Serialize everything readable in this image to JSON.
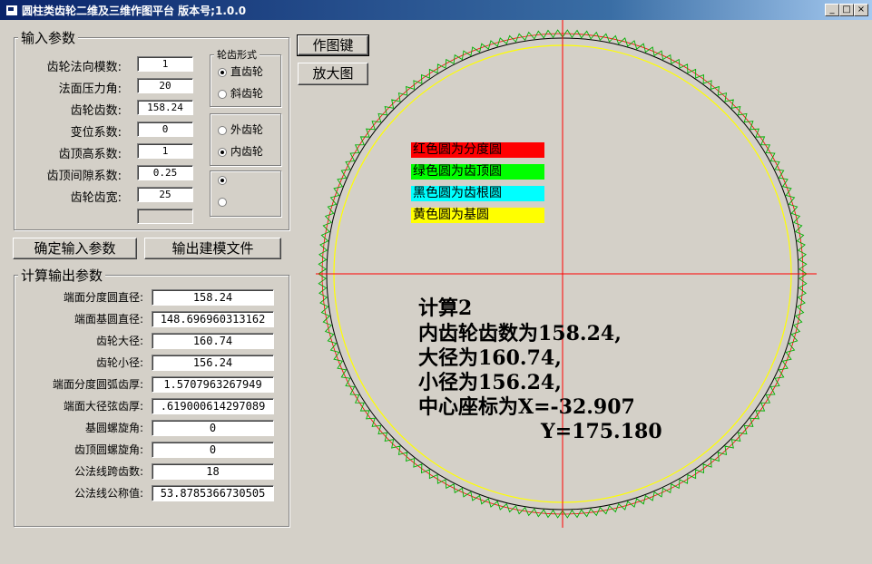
{
  "window": {
    "title": "圆柱类齿轮二维及三维作图平台 版本号;1.0.0",
    "controls": {
      "minimize": "_",
      "maximize": "□",
      "close": "×"
    }
  },
  "input": {
    "legend": "输入参数",
    "fields": [
      {
        "label": "齿轮法向模数:",
        "value": "1"
      },
      {
        "label": "法面压力角:",
        "value": "20"
      },
      {
        "label": "齿轮齿数:",
        "value": "158.24"
      },
      {
        "label": "变位系数:",
        "value": "0"
      },
      {
        "label": "齿顶高系数:",
        "value": "1"
      },
      {
        "label": "齿顶间隙系数:",
        "value": "0.25"
      },
      {
        "label": "齿轮齿宽:",
        "value": "25"
      }
    ],
    "extra_value": ""
  },
  "gear_type": {
    "legend": "轮齿形式",
    "options": [
      {
        "label": "直齿轮",
        "checked": true
      },
      {
        "label": "斜齿轮",
        "checked": false
      }
    ]
  },
  "mesh_type": {
    "options": [
      {
        "label": "外齿轮",
        "checked": false
      },
      {
        "label": "内齿轮",
        "checked": true
      }
    ]
  },
  "third_group": {
    "options": [
      {
        "label": "",
        "checked": true
      },
      {
        "label": "",
        "checked": false
      }
    ]
  },
  "buttons": {
    "draw": "作图键",
    "zoom": "放大图",
    "confirm": "确定输入参数",
    "export": "输出建模文件"
  },
  "output": {
    "legend": "计算输出参数",
    "fields": [
      {
        "label": "端面分度圆直径:",
        "value": "158.24"
      },
      {
        "label": "端面基圆直径:",
        "value": "148.696960313162"
      },
      {
        "label": "齿轮大径:",
        "value": "160.74"
      },
      {
        "label": "齿轮小径:",
        "value": "156.24"
      },
      {
        "label": "端面分度圆弧齿厚:",
        "value": "1.5707963267949"
      },
      {
        "label": "端面大径弦齿厚:",
        "value": ".619000614297089"
      },
      {
        "label": "基圆螺旋角:",
        "value": "0"
      },
      {
        "label": "齿顶圆螺旋角:",
        "value": "0"
      },
      {
        "label": "公法线跨齿数:",
        "value": "18"
      },
      {
        "label": "公法线公称值:",
        "value": "53.8785366730505"
      }
    ]
  },
  "legend_keys": [
    {
      "text": "红色圆为分度圆",
      "color": "#ff0000"
    },
    {
      "text": "绿色圆为齿顶圆",
      "color": "#00ff00"
    },
    {
      "text": "黑色圆为齿根圆",
      "color": "#00ffff"
    },
    {
      "text": "黄色圆为基圆",
      "color": "#ffff00"
    }
  ],
  "result": {
    "line1": "计算2",
    "line2": "内齿轮齿数为158.24,",
    "line3": "大径为160.74,",
    "line4": "小径为156.24,",
    "line5": "中心座标为X=-32.907",
    "line6": "Y=175.180"
  },
  "drawing": {
    "teeth": 158,
    "colors": {
      "pitch": "#ff0000",
      "tip": "#00b000",
      "root": "#000000",
      "base": "#ffff00",
      "axis": "#ff0000"
    }
  }
}
